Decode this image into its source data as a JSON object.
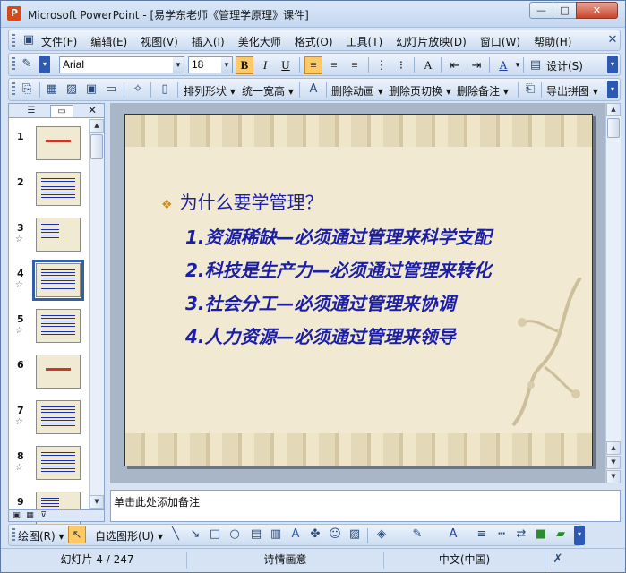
{
  "window": {
    "title": "Microsoft PowerPoint - [易学东老师《管理学原理》课件]",
    "app_icon_glyph": "P",
    "buttons": {
      "minimize": "—",
      "maximize": "□",
      "close": "✕"
    }
  },
  "menubar": {
    "items": [
      "文件(F)",
      "编辑(E)",
      "视图(V)",
      "插入(I)",
      "美化大师",
      "格式(O)",
      "工具(T)",
      "幻灯片放映(D)",
      "窗口(W)",
      "帮助(H)"
    ]
  },
  "format_toolbar": {
    "font_name": "Arial",
    "font_size": "18",
    "bold": "B",
    "italic": "I",
    "underline": "U",
    "design_label": "设计(S)"
  },
  "toolbar3": {
    "arrange_label": "排列形状",
    "uniform_label": "统一宽高",
    "delete_anim_label": "删除动画",
    "delete_trans_label": "删除页切换",
    "delete_notes_label": "删除备注",
    "export_label": "导出拼图"
  },
  "slide_pane": {
    "close_glyph": "✕",
    "slides": [
      {
        "num": "1",
        "has_star": false,
        "kind": "title"
      },
      {
        "num": "2",
        "has_star": false,
        "kind": "dense"
      },
      {
        "num": "3",
        "has_star": true,
        "kind": "sparse"
      },
      {
        "num": "4",
        "has_star": true,
        "kind": "dense",
        "selected": true
      },
      {
        "num": "5",
        "has_star": true,
        "kind": "dense"
      },
      {
        "num": "6",
        "has_star": false,
        "kind": "title"
      },
      {
        "num": "7",
        "has_star": true,
        "kind": "dense"
      },
      {
        "num": "8",
        "has_star": true,
        "kind": "dense"
      },
      {
        "num": "9",
        "has_star": true,
        "kind": "sparse"
      }
    ],
    "star_glyph": "☆"
  },
  "slide": {
    "heading": "为什么要学管理？",
    "bullet_glyph": "❖",
    "points": [
      "1.资源稀缺—必须通过管理来科学支配",
      "2.科技是生产力—必须通过管理来转化",
      "3.社会分工—必须通过管理来协调",
      "4.人力资源—必须通过管理来领导"
    ]
  },
  "notes": {
    "placeholder": "单击此处添加备注"
  },
  "drawing_toolbar": {
    "draw_label": "绘图(R)",
    "autoshape_label": "自选图形(U)"
  },
  "statusbar": {
    "slide_position": "幻灯片 4 / 247",
    "theme": "诗情画意",
    "language": "中文(中国)"
  },
  "colors": {
    "slide_text": "#1b1fa6",
    "bullet": "#d08a1c",
    "selection": "#355ea8"
  }
}
